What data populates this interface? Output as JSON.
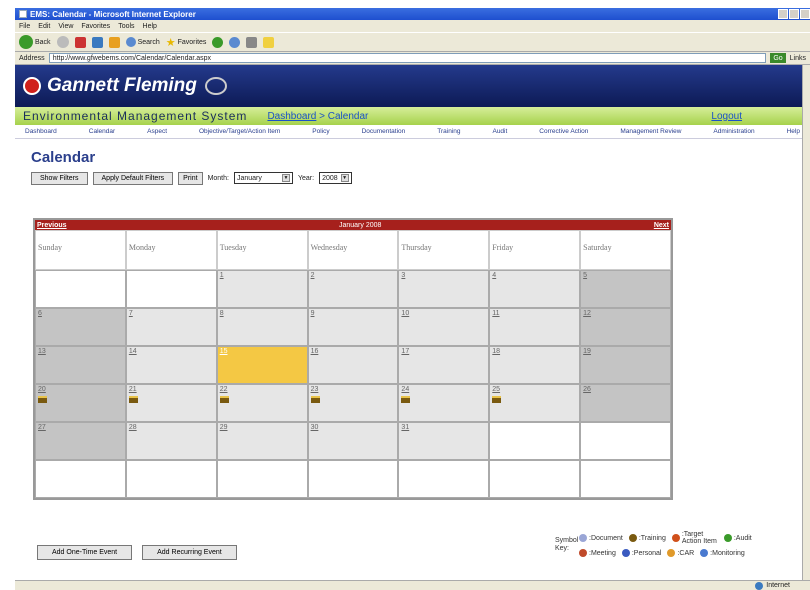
{
  "window": {
    "title": "EMS: Calendar - Microsoft Internet Explorer"
  },
  "menu": [
    "File",
    "Edit",
    "View",
    "Favorites",
    "Tools",
    "Help"
  ],
  "toolbar": {
    "back": "Back",
    "search": "Search",
    "favorites": "Favorites"
  },
  "address": {
    "label": "Address",
    "url": "http://www.gfwebems.com/Calendar/Calendar.aspx",
    "go": "Go",
    "links": "Links"
  },
  "banner": {
    "brand": "Gannett Fleming"
  },
  "ems": {
    "title": "Environmental Management System",
    "crumb_link": "Dashboard",
    "crumb_current": "> Calendar",
    "logout": "Logout"
  },
  "nav": [
    "Dashboard",
    "Calendar",
    "Aspect",
    "Objective/Target/Action Item",
    "Policy",
    "Documentation",
    "Training",
    "Audit",
    "Corrective Action",
    "Management Review",
    "Administration",
    "Help"
  ],
  "page": {
    "title": "Calendar"
  },
  "filters": {
    "show": "Show Filters",
    "apply": "Apply Default Filters",
    "print": "Print",
    "month_label": "Month:",
    "month": "January",
    "year_label": "Year:",
    "year": "2008"
  },
  "calendar": {
    "prev": "Previous",
    "next": "Next",
    "title": "January 2008",
    "days": [
      "Sunday",
      "Monday",
      "Tuesday",
      "Wednesday",
      "Thursday",
      "Friday",
      "Saturday"
    ],
    "weeks": [
      [
        "",
        "",
        "1",
        "2",
        "3",
        "4",
        "5"
      ],
      [
        "6",
        "7",
        "8",
        "9",
        "10",
        "11",
        "12"
      ],
      [
        "13",
        "14",
        "15",
        "16",
        "17",
        "18",
        "19"
      ],
      [
        "20",
        "21",
        "22",
        "23",
        "24",
        "25",
        "26"
      ],
      [
        "27",
        "28",
        "29",
        "30",
        "31",
        "",
        ""
      ],
      [
        "",
        "",
        "",
        "",
        "",
        "",
        ""
      ]
    ],
    "today": "15",
    "training_days": [
      "20",
      "21",
      "22",
      "23",
      "24",
      "25"
    ]
  },
  "buttons": {
    "one_time": "Add One-Time Event",
    "recurring": "Add Recurring Event"
  },
  "key": {
    "label": "Symbol Key:",
    "row1": [
      {
        "icon": "document-icon",
        "text": ":Document",
        "color": "#9aa6d6"
      },
      {
        "icon": "training-icon",
        "text": ":Training",
        "color": "#7a5a10"
      },
      {
        "icon": "target-icon",
        "text": ":Target Action Item",
        "color": "#d0501b"
      },
      {
        "icon": "audit-icon",
        "text": ":Audit",
        "color": "#3a9a2a"
      }
    ],
    "row2": [
      {
        "icon": "meeting-icon",
        "text": ":Meeting",
        "color": "#c04a2a"
      },
      {
        "icon": "personal-icon",
        "text": ":Personal",
        "color": "#3a5ac0"
      },
      {
        "icon": "car-icon",
        "text": ":CAR",
        "color": "#e09a2a"
      },
      {
        "icon": "monitoring-icon",
        "text": ":Monitoring",
        "color": "#4a7ad0"
      }
    ]
  },
  "status": {
    "zone": "Internet"
  }
}
